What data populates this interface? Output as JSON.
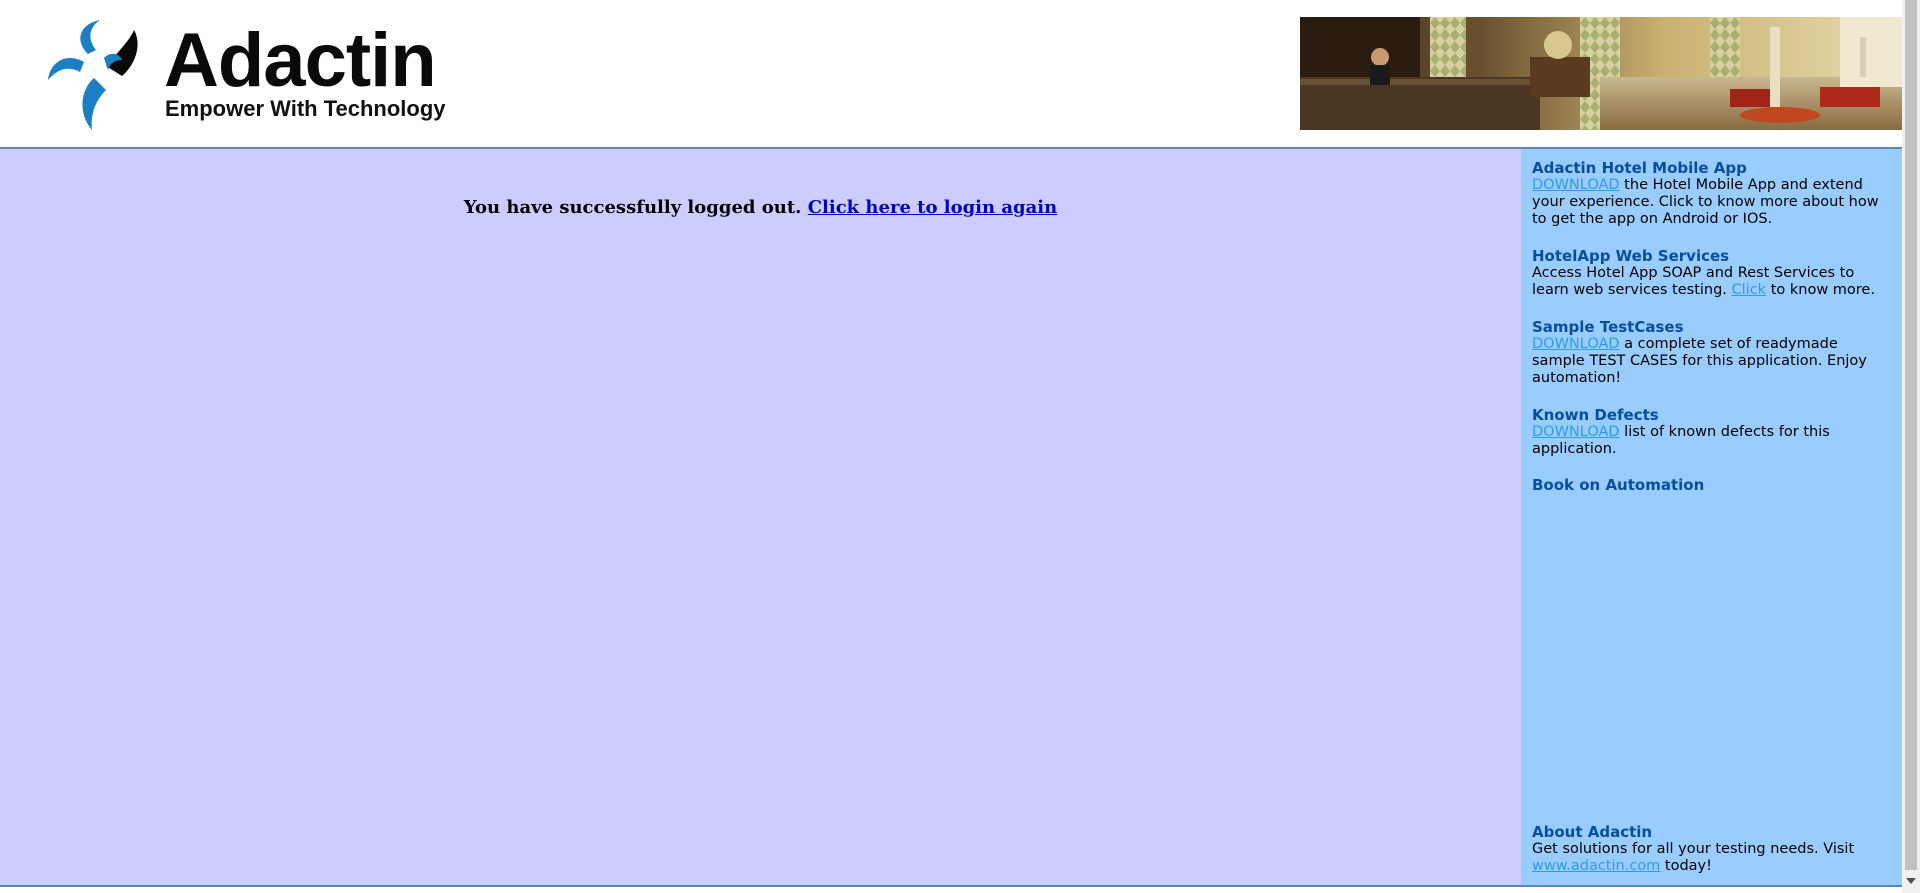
{
  "header": {
    "logo_name": "Adactin",
    "logo_tagline": "Empower With Technology"
  },
  "main": {
    "logout_text": "You have successfully logged out.",
    "login_link": "Click here to login again"
  },
  "sidebar": {
    "mobile_app": {
      "title": "Adactin Hotel Mobile App",
      "link": "DOWNLOAD",
      "text": " the Hotel Mobile App and extend your experience. Click to know more about how to get the app on Android or IOS."
    },
    "web_services": {
      "title": "HotelApp Web Services",
      "text_before": "Access Hotel App SOAP and Rest Services to learn web services testing. ",
      "link": "Click",
      "text_after": " to know more."
    },
    "test_cases": {
      "title": "Sample TestCases",
      "link": "DOWNLOAD",
      "text": " a complete set of readymade sample TEST CASES for this application. Enjoy automation!"
    },
    "known_defects": {
      "title": "Known Defects",
      "link": "DOWNLOAD",
      "text": " list of known defects for this application."
    },
    "book": {
      "title": "Book on Automation"
    },
    "about": {
      "title": "About Adactin",
      "text": "Get solutions for all your testing needs. Visit ",
      "link": "www.adactin.com",
      "text_after": " today!"
    }
  },
  "colors": {
    "main_bg": "#ccccff",
    "sidebar_bg": "#99ccff",
    "title_color": "#084ea0",
    "link_color": "#2a9df0",
    "rule_color": "#5b87b5"
  },
  "icons": {
    "logo_mark": "adactin-logo-icon",
    "banner": "hotel-lobby-banner-image",
    "scroll_down": "scroll-down-arrow-icon"
  }
}
